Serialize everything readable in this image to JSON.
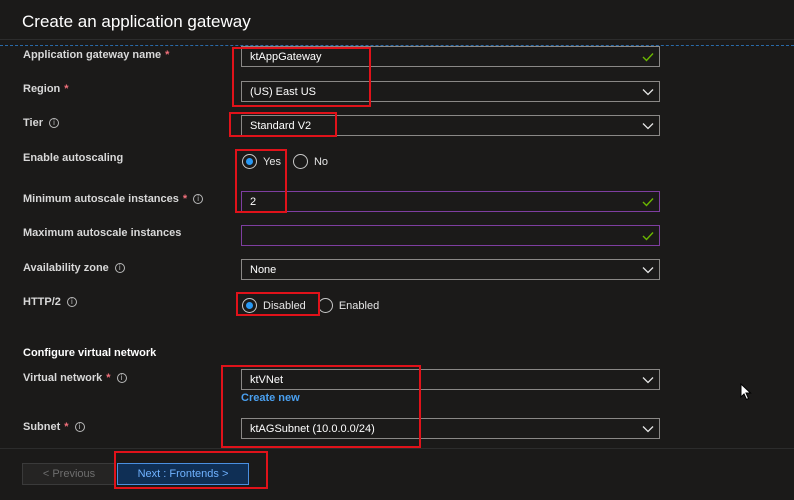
{
  "page": {
    "title": "Create an application gateway"
  },
  "fields": {
    "gateway_name": {
      "label": "Application gateway name",
      "required": "*",
      "value": "ktAppGateway"
    },
    "region": {
      "label": "Region",
      "required": "*",
      "value": "(US) East US"
    },
    "tier": {
      "label": "Tier",
      "value": "Standard V2"
    },
    "autoscaling": {
      "label": "Enable autoscaling",
      "options": [
        "Yes",
        "No"
      ],
      "selected": "Yes"
    },
    "min_instances": {
      "label": "Minimum autoscale instances",
      "required": "*",
      "value": "2"
    },
    "max_instances": {
      "label": "Maximum autoscale instances",
      "value": ""
    },
    "availability_zone": {
      "label": "Availability zone",
      "value": "None"
    },
    "http2": {
      "label": "HTTP/2",
      "options": [
        "Disabled",
        "Enabled"
      ],
      "selected": "Disabled"
    }
  },
  "network": {
    "section_title": "Configure virtual network",
    "vnet": {
      "label": "Virtual network",
      "required": "*",
      "value": "ktVNet",
      "create_new": "Create new"
    },
    "subnet": {
      "label": "Subnet",
      "required": "*",
      "value": "ktAGSubnet (10.0.0.0/24)"
    }
  },
  "footer": {
    "previous_label": "< Previous",
    "next_label": "Next : Frontends >"
  },
  "colors": {
    "background": "#1b1a19",
    "accent": "#2899f5",
    "required": "#f1707b",
    "highlight": "#e0121a",
    "valid_check": "#6bb700",
    "link": "#4aa0f0"
  },
  "icons": {
    "dropdown": "chevron-down-icon",
    "valid": "checkmark-icon",
    "info": "info-icon",
    "cursor": "mouse-pointer-icon"
  }
}
